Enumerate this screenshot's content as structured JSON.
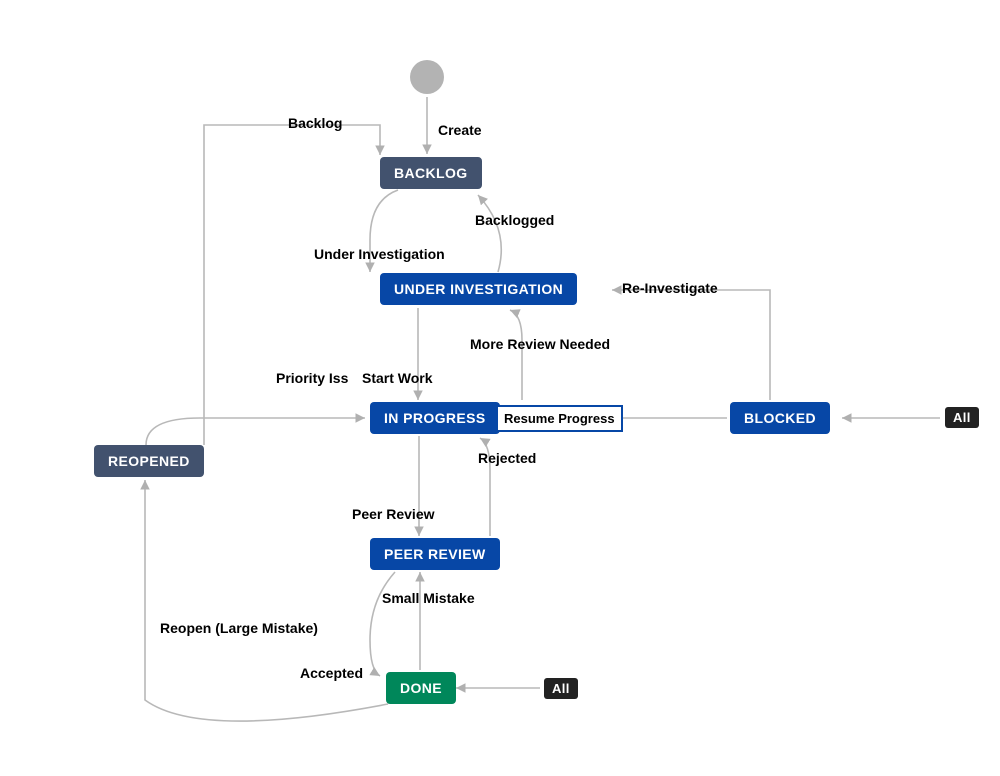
{
  "nodes": {
    "backlog": "BACKLOG",
    "under_investigation": "UNDER INVESTIGATION",
    "in_progress": "IN PROGRESS",
    "peer_review": "PEER REVIEW",
    "done": "DONE",
    "reopened": "REOPENED",
    "blocked": "BLOCKED"
  },
  "chips": {
    "all1": "All",
    "all2": "All"
  },
  "edges": {
    "create": "Create",
    "backlog": "Backlog",
    "backlogged": "Backlogged",
    "under_investigation": "Under Investigation",
    "re_investigate": "Re-Investigate",
    "more_review_needed": "More Review Needed",
    "start_work": "Start Work",
    "priority_iss": "Priority Iss",
    "resume_progress": "Resume Progress",
    "rejected": "Rejected",
    "peer_review": "Peer Review",
    "small_mistake": "Small Mistake",
    "accepted": "Accepted",
    "reopen_large_mistake": "Reopen (Large Mistake)"
  }
}
